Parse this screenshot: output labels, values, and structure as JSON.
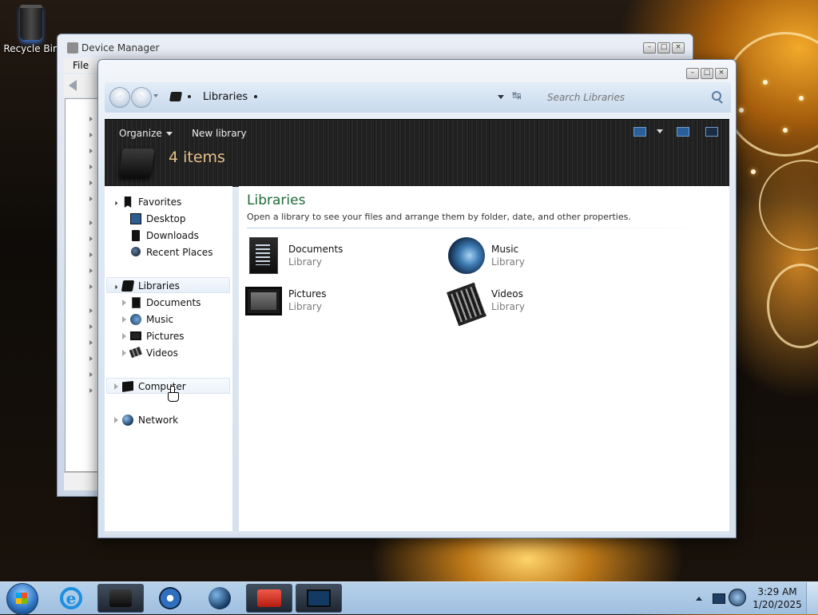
{
  "desktop": {
    "recycle_bin_label": "Recycle Bin"
  },
  "device_manager": {
    "title": "Device Manager",
    "menu_file": "File",
    "controls": {
      "minimize": "–",
      "maximize": "□",
      "close": "×"
    }
  },
  "explorer": {
    "controls": {
      "minimize": "–",
      "maximize": "□",
      "close": "×"
    },
    "breadcrumb": "Libraries",
    "search_placeholder": "Search Libraries",
    "refresh_glyph": "↹",
    "toolbar": {
      "organize": "Organize",
      "new_library": "New library"
    },
    "item_count": "4 items",
    "nav": {
      "favorites": "Favorites",
      "desktop": "Desktop",
      "downloads": "Downloads",
      "recent_places": "Recent Places",
      "libraries": "Libraries",
      "documents": "Documents",
      "music": "Music",
      "pictures": "Pictures",
      "videos": "Videos",
      "computer": "Computer",
      "network": "Network"
    },
    "content": {
      "title": "Libraries",
      "subtitle": "Open a library to see your files and arrange them by folder, date, and other properties.",
      "tiles": [
        {
          "name": "Documents",
          "type": "Library",
          "icon": "documents-icon"
        },
        {
          "name": "Music",
          "type": "Library",
          "icon": "music-icon"
        },
        {
          "name": "Pictures",
          "type": "Library",
          "icon": "pictures-icon"
        },
        {
          "name": "Videos",
          "type": "Library",
          "icon": "videos-icon"
        }
      ]
    }
  },
  "taskbar": {
    "ie_glyph": "e",
    "clock_time": "3:29 AM",
    "clock_date": "1/20/2025"
  },
  "colors": {
    "library_title": "#1e6a39",
    "item_count": "#e6c08a",
    "taskbar": "#b7d1ea"
  }
}
